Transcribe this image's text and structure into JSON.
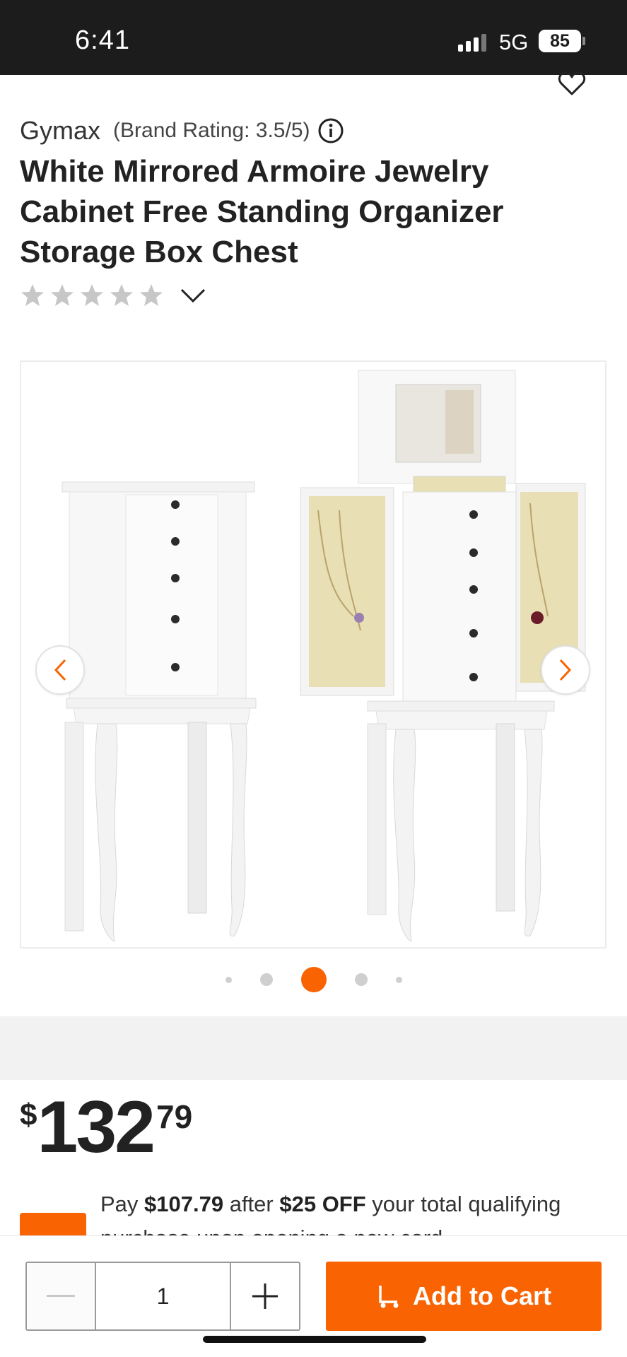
{
  "status_bar": {
    "time": "6:41",
    "network": "5G",
    "battery": "85"
  },
  "product": {
    "brand": "Gymax",
    "brand_rating": "(Brand Rating: 3.5/5)",
    "title": "White Mirrored Armoire Jewelry Cabinet Free Standing Organizer Storage Box Chest",
    "rating_stars": 0
  },
  "gallery": {
    "active_index": 2,
    "dot_count": 5
  },
  "price": {
    "dollar_sign": "$",
    "whole": "132",
    "cents": "79"
  },
  "promo": {
    "prefix": "Pay ",
    "amount": "$107.79",
    "mid": " after ",
    "discount": "$25 OFF",
    "suffix": " your total qualifying purchase upon opening a new card."
  },
  "cart": {
    "quantity": "1",
    "add_label": "Add to Cart"
  },
  "colors": {
    "accent": "#f96302",
    "status_bg": "#1c1c1c"
  }
}
